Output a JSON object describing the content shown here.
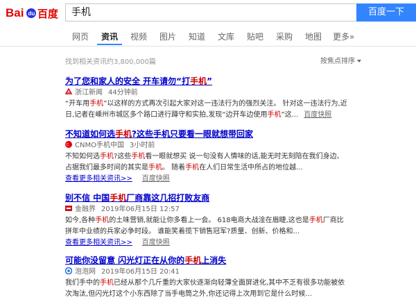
{
  "search": {
    "query": "手机",
    "button_label": "百度一下"
  },
  "tabs": [
    {
      "label": "网页"
    },
    {
      "label": "资讯"
    },
    {
      "label": "视频"
    },
    {
      "label": "图片"
    },
    {
      "label": "知道"
    },
    {
      "label": "文库"
    },
    {
      "label": "贴吧"
    },
    {
      "label": "采购"
    },
    {
      "label": "地图"
    },
    {
      "label": "更多»"
    }
  ],
  "result_count": "找到相关资讯约3,800,000篇",
  "sort_label": "按焦点排序",
  "results": [
    {
      "title_pre": "为了您和家人的安全 开车请勿“打",
      "title_hl": "手机",
      "title_post": "”",
      "source": "浙江新闻",
      "time": "44分钟前",
      "icon": "zjnews-icon",
      "abstract_parts": [
        {
          "t": "“开车用"
        },
        {
          "t": "手机",
          "hl": true
        },
        {
          "t": "”以这样的方式再次引起大家对这一违法行为的强烈关注。 针对这一违法行为,近日,记者在嵊州市城区多个路口进行蹲守和实拍,发现“边开车边使用"
        },
        {
          "t": "手机",
          "hl": true
        },
        {
          "t": "”这..."
        }
      ],
      "snapshot": "百度快照"
    },
    {
      "title_pre": "不知道如何选",
      "title_hl": "手机",
      "title_post": "?这些手机只要看一眼就想带回家",
      "source": "CNMO手机中国",
      "time": "3小时前",
      "icon": "cnmo-icon",
      "abstract_parts": [
        {
          "t": "不知如何选"
        },
        {
          "t": "手机",
          "hl": true
        },
        {
          "t": "?这些"
        },
        {
          "t": "手机",
          "hl": true
        },
        {
          "t": "看一眼就想买 说一句没有人情味的话,能无时无刻陪在我们身边、占据我们最多时间的其实是"
        },
        {
          "t": "手机",
          "hl": true
        },
        {
          "t": "。 随着"
        },
        {
          "t": "手机",
          "hl": true
        },
        {
          "t": "在人们日常生活中所占的地位越..."
        }
      ],
      "more": "查看更多相关资讯>>",
      "snapshot": "百度快照"
    },
    {
      "title_pre": "别不信 中国",
      "title_hl": "手机",
      "title_post": "厂商靠这几招打败友商",
      "source": "金融界",
      "time": "2019年06月15日 12:57",
      "icon": "jrj-icon",
      "abstract_parts": [
        {
          "t": "如今,各种"
        },
        {
          "t": "手机",
          "hl": true
        },
        {
          "t": "的土味营销,就能让你多看上一会。 618电商大战淦在眉睫,这也是"
        },
        {
          "t": "手机",
          "hl": true
        },
        {
          "t": "厂商比拼年中业绩的兵家必争时段。 谁能笑着揽下销售冠军?质量、创新、价格和..."
        }
      ],
      "more": "查看更多相关资讯>>",
      "snapshot": "百度快照"
    },
    {
      "title_pre": "可能你没留意 闪光灯正在从你的",
      "title_hl": "手机",
      "title_post": "上消失",
      "source": "泡泡网",
      "time": "2019年06月15日 20:41",
      "icon": "pcpop-icon",
      "abstract_parts": [
        {
          "t": "我们手中的"
        },
        {
          "t": "手机",
          "hl": true
        },
        {
          "t": "已经从那个几斤重的大家伙逐渐向轻薄全面屏进化,其中不乏有很多功能被依次淘汰,但闪光灯这个小东西除了当手电筒之外,你还记得上次用到它是什么时候..."
        }
      ]
    }
  ],
  "colors": {
    "accent": "#3385ff",
    "link": "#0000cc",
    "highlight": "#cc0000"
  }
}
